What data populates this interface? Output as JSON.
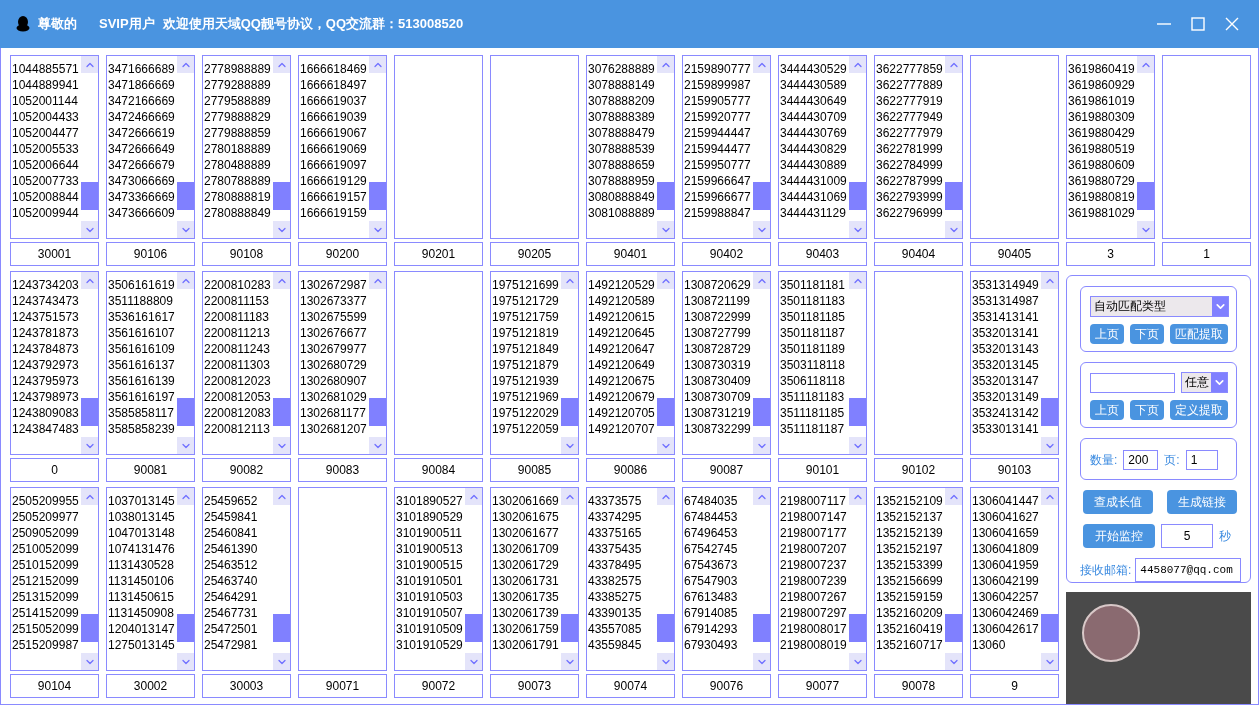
{
  "title_bar": {
    "greeting": "尊敬的",
    "user_level": "SVIP用户",
    "message": "欢迎使用天域QQ靓号协议，QQ交流群：513008520"
  },
  "rows": [
    {
      "panels": [
        {
          "items": [
            "1044885571",
            "1044889941",
            "1052001144",
            "1052004433",
            "1052004477",
            "1052005533",
            "1052006644",
            "1052007733",
            "1052008844",
            "1052009944"
          ],
          "code": "30001"
        },
        {
          "items": [
            "3471666689",
            "3471866669",
            "3472166669",
            "3472466669",
            "3472666619",
            "3472666649",
            "3472666679",
            "3473066669",
            "3473366669",
            "3473666609"
          ],
          "code": "90106"
        },
        {
          "items": [
            "2778988889",
            "2779288889",
            "2779588889",
            "2779888829",
            "2779888859",
            "2780188889",
            "2780488889",
            "2780788889",
            "2780888819",
            "2780888849"
          ],
          "code": "90108"
        },
        {
          "items": [
            "1666618469",
            "1666618497",
            "1666619037",
            "1666619039",
            "1666619067",
            "1666619069",
            "1666619097",
            "1666619129",
            "1666619157",
            "1666619159"
          ],
          "code": "90200"
        },
        {
          "code": "90201"
        },
        {
          "code": "90205"
        },
        {
          "items": [
            "3076288889",
            "3078888149",
            "3078888209",
            "3078888389",
            "3078888479",
            "3078888539",
            "3078888659",
            "3078888959",
            "3080888849",
            "3081088889"
          ],
          "code": "90401"
        },
        {
          "items": [
            "2159890777",
            "2159899987",
            "2159905777",
            "2159920777",
            "2159944447",
            "2159944477",
            "2159950777",
            "2159966647",
            "2159966677",
            "2159988847"
          ],
          "code": "90402"
        },
        {
          "items": [
            "3444430529",
            "3444430589",
            "3444430649",
            "3444430709",
            "3444430769",
            "3444430829",
            "3444430889",
            "3444431009",
            "3444431069",
            "3444431129"
          ],
          "code": "90403"
        },
        {
          "items": [
            "3622777859",
            "3622777889",
            "3622777919",
            "3622777949",
            "3622777979",
            "3622781999",
            "3622784999",
            "3622787999",
            "3622793999",
            "3622796999"
          ],
          "code": "90404"
        },
        {
          "code": "90405"
        },
        {
          "items": [
            "3619860419",
            "3619860929",
            "3619861019",
            "3619880309",
            "3619880429",
            "3619880519",
            "3619880609",
            "3619880729",
            "3619880819",
            "3619881029"
          ],
          "code": "3"
        },
        {
          "code": "1"
        }
      ]
    },
    {
      "panels": [
        {
          "items": [
            "1243734203",
            "1243743473",
            "1243751573",
            "1243781873",
            "1243784873",
            "1243792973",
            "1243795973",
            "1243798973",
            "1243809083",
            "1243847483"
          ],
          "code": "0"
        },
        {
          "items": [
            "3506161619",
            "3511188809",
            "3536161617",
            "3561616107",
            "3561616109",
            "3561616137",
            "3561616139",
            "3561616197",
            "3585858117",
            "3585858239"
          ],
          "code": "90081"
        },
        {
          "items": [
            "2200810283",
            "2200811153",
            "2200811183",
            "2200811213",
            "2200811243",
            "2200811303",
            "2200812023",
            "2200812053",
            "2200812083",
            "2200812113"
          ],
          "code": "90082"
        },
        {
          "items": [
            "1302672987",
            "1302673377",
            "1302675599",
            "1302676677",
            "1302679977",
            "1302680729",
            "1302680907",
            "1302681029",
            "1302681177",
            "1302681207"
          ],
          "code": "90083"
        },
        {
          "code": "90084"
        },
        {
          "items": [
            "1975121699",
            "1975121729",
            "1975121759",
            "1975121819",
            "1975121849",
            "1975121879",
            "1975121939",
            "1975121969",
            "1975122029",
            "1975122059"
          ],
          "code": "90085"
        },
        {
          "items": [
            "1492120529",
            "1492120589",
            "1492120615",
            "1492120645",
            "1492120647",
            "1492120649",
            "1492120675",
            "1492120679",
            "1492120705",
            "1492120707"
          ],
          "code": "90086"
        },
        {
          "items": [
            "1308720629",
            "1308721199",
            "1308722999",
            "1308727799",
            "1308728729",
            "1308730319",
            "1308730409",
            "1308730709",
            "1308731219",
            "1308732299"
          ],
          "code": "90087"
        },
        {
          "items": [
            "3501181181",
            "3501181183",
            "3501181185",
            "3501181187",
            "3501181189",
            "3503118118",
            "3506118118",
            "3511181183",
            "3511181185",
            "3511181187"
          ],
          "code": "90101"
        },
        {
          "code": "90102"
        },
        {
          "items": [
            "3531314949",
            "3531314987",
            "3531413141",
            "3532013141",
            "3532013143",
            "3532013145",
            "3532013147",
            "3532013149",
            "3532413142",
            "3533013141"
          ],
          "code": "90103"
        }
      ]
    },
    {
      "panels": [
        {
          "items": [
            "2505209955",
            "2505209977",
            "2509052099",
            "2510052099",
            "2510152099",
            "2512152099",
            "2513152099",
            "2514152099",
            "2515052099",
            "2515209987"
          ],
          "code": "90104"
        },
        {
          "items": [
            "1037013145",
            "1038013145",
            "1047013148",
            "1074131476",
            "1131430528",
            "1131450106",
            "1131450615",
            "1131450908",
            "1204013147",
            "1275013145"
          ],
          "code": "30002"
        },
        {
          "items": [
            "25459652",
            "25459841",
            "25460841",
            "25461390",
            "25463512",
            "25463740",
            "25464291",
            "25467731",
            "25472501",
            "25472981"
          ],
          "code": "30003"
        },
        {
          "code": "90071"
        },
        {
          "items": [
            "3101890527",
            "3101890529",
            "3101900511",
            "3101900513",
            "3101900515",
            "3101910501",
            "3101910503",
            "3101910507",
            "3101910509",
            "3101910529"
          ],
          "code": "90072"
        },
        {
          "items": [
            "1302061669",
            "1302061675",
            "1302061677",
            "1302061709",
            "1302061729",
            "1302061731",
            "1302061735",
            "1302061739",
            "1302061759",
            "1302061791"
          ],
          "code": "90073"
        },
        {
          "items": [
            "43373575",
            "43374295",
            "43375165",
            "43375435",
            "43378495",
            "43382575",
            "43385275",
            "43390135",
            "43557085",
            "43559845"
          ],
          "code": "90074"
        },
        {
          "items": [
            "67484035",
            "67484453",
            "67496453",
            "67542745",
            "67543673",
            "67547903",
            "67613483",
            "67914085",
            "67914293",
            "67930493"
          ],
          "code": "90076"
        },
        {
          "items": [
            "2198007117",
            "2198007147",
            "2198007177",
            "2198007207",
            "2198007237",
            "2198007239",
            "2198007267",
            "2198007297",
            "2198008017",
            "2198008019"
          ],
          "code": "90077"
        },
        {
          "items": [
            "1352152109",
            "1352152137",
            "1352152139",
            "1352152197",
            "1352153399",
            "1352156699",
            "1352159159",
            "1352160209",
            "1352160419",
            "1352160717"
          ],
          "code": "90078"
        },
        {
          "items": [
            "1306041447",
            "1306041627",
            "1306041659",
            "1306041809",
            "1306041959",
            "1306042199",
            "1306042257",
            "1306042469",
            "1306042617",
            "13060"
          ],
          "code": "9"
        }
      ]
    }
  ],
  "control_panel": {
    "match_group": {
      "dropdown": "自动匹配类型",
      "buttons": [
        "上页",
        "下页",
        "匹配提取"
      ]
    },
    "custom_group": {
      "dropdown": "任意",
      "buttons": [
        "上页",
        "下页",
        "定义提取"
      ]
    },
    "paging_group": {
      "count_label": "数量:",
      "count": "200",
      "page_label": "页:",
      "page": "1"
    },
    "buttons": [
      "查成长值",
      "生成链接"
    ],
    "monitor": {
      "button": "开始监控",
      "interval": "5",
      "unit": "秒"
    },
    "email": {
      "label": "接收邮箱:",
      "value": "4458077@qq.com"
    }
  }
}
